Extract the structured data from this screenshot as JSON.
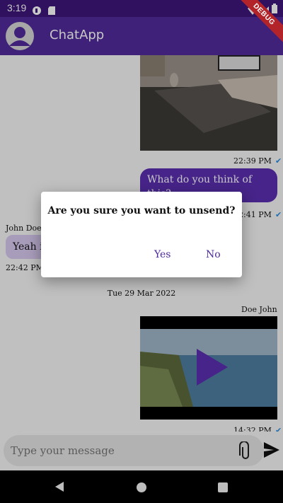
{
  "status_bar": {
    "time": "3:19"
  },
  "app_bar": {
    "title": "ChatApp",
    "debug_banner": "DEBUG"
  },
  "messages": {
    "image_msg_time": "22:39 PM",
    "text_msg": {
      "text": "What do you think of this?",
      "time": "22:41 PM"
    },
    "incoming": {
      "sender": "John Doe",
      "text": "Yeah i",
      "time": "22:42 PM"
    },
    "date_divider": "Tue 29 Mar 2022",
    "video_msg": {
      "sender": "Doe John",
      "time": "14:32 PM"
    }
  },
  "composer": {
    "placeholder": "Type your message"
  },
  "dialog": {
    "title": "Are you sure you want to unsend?",
    "yes_label": "Yes",
    "no_label": "No"
  },
  "colors": {
    "primary": "#512b9b",
    "accent": "#5a2fb0",
    "check": "#2b8ee0"
  }
}
